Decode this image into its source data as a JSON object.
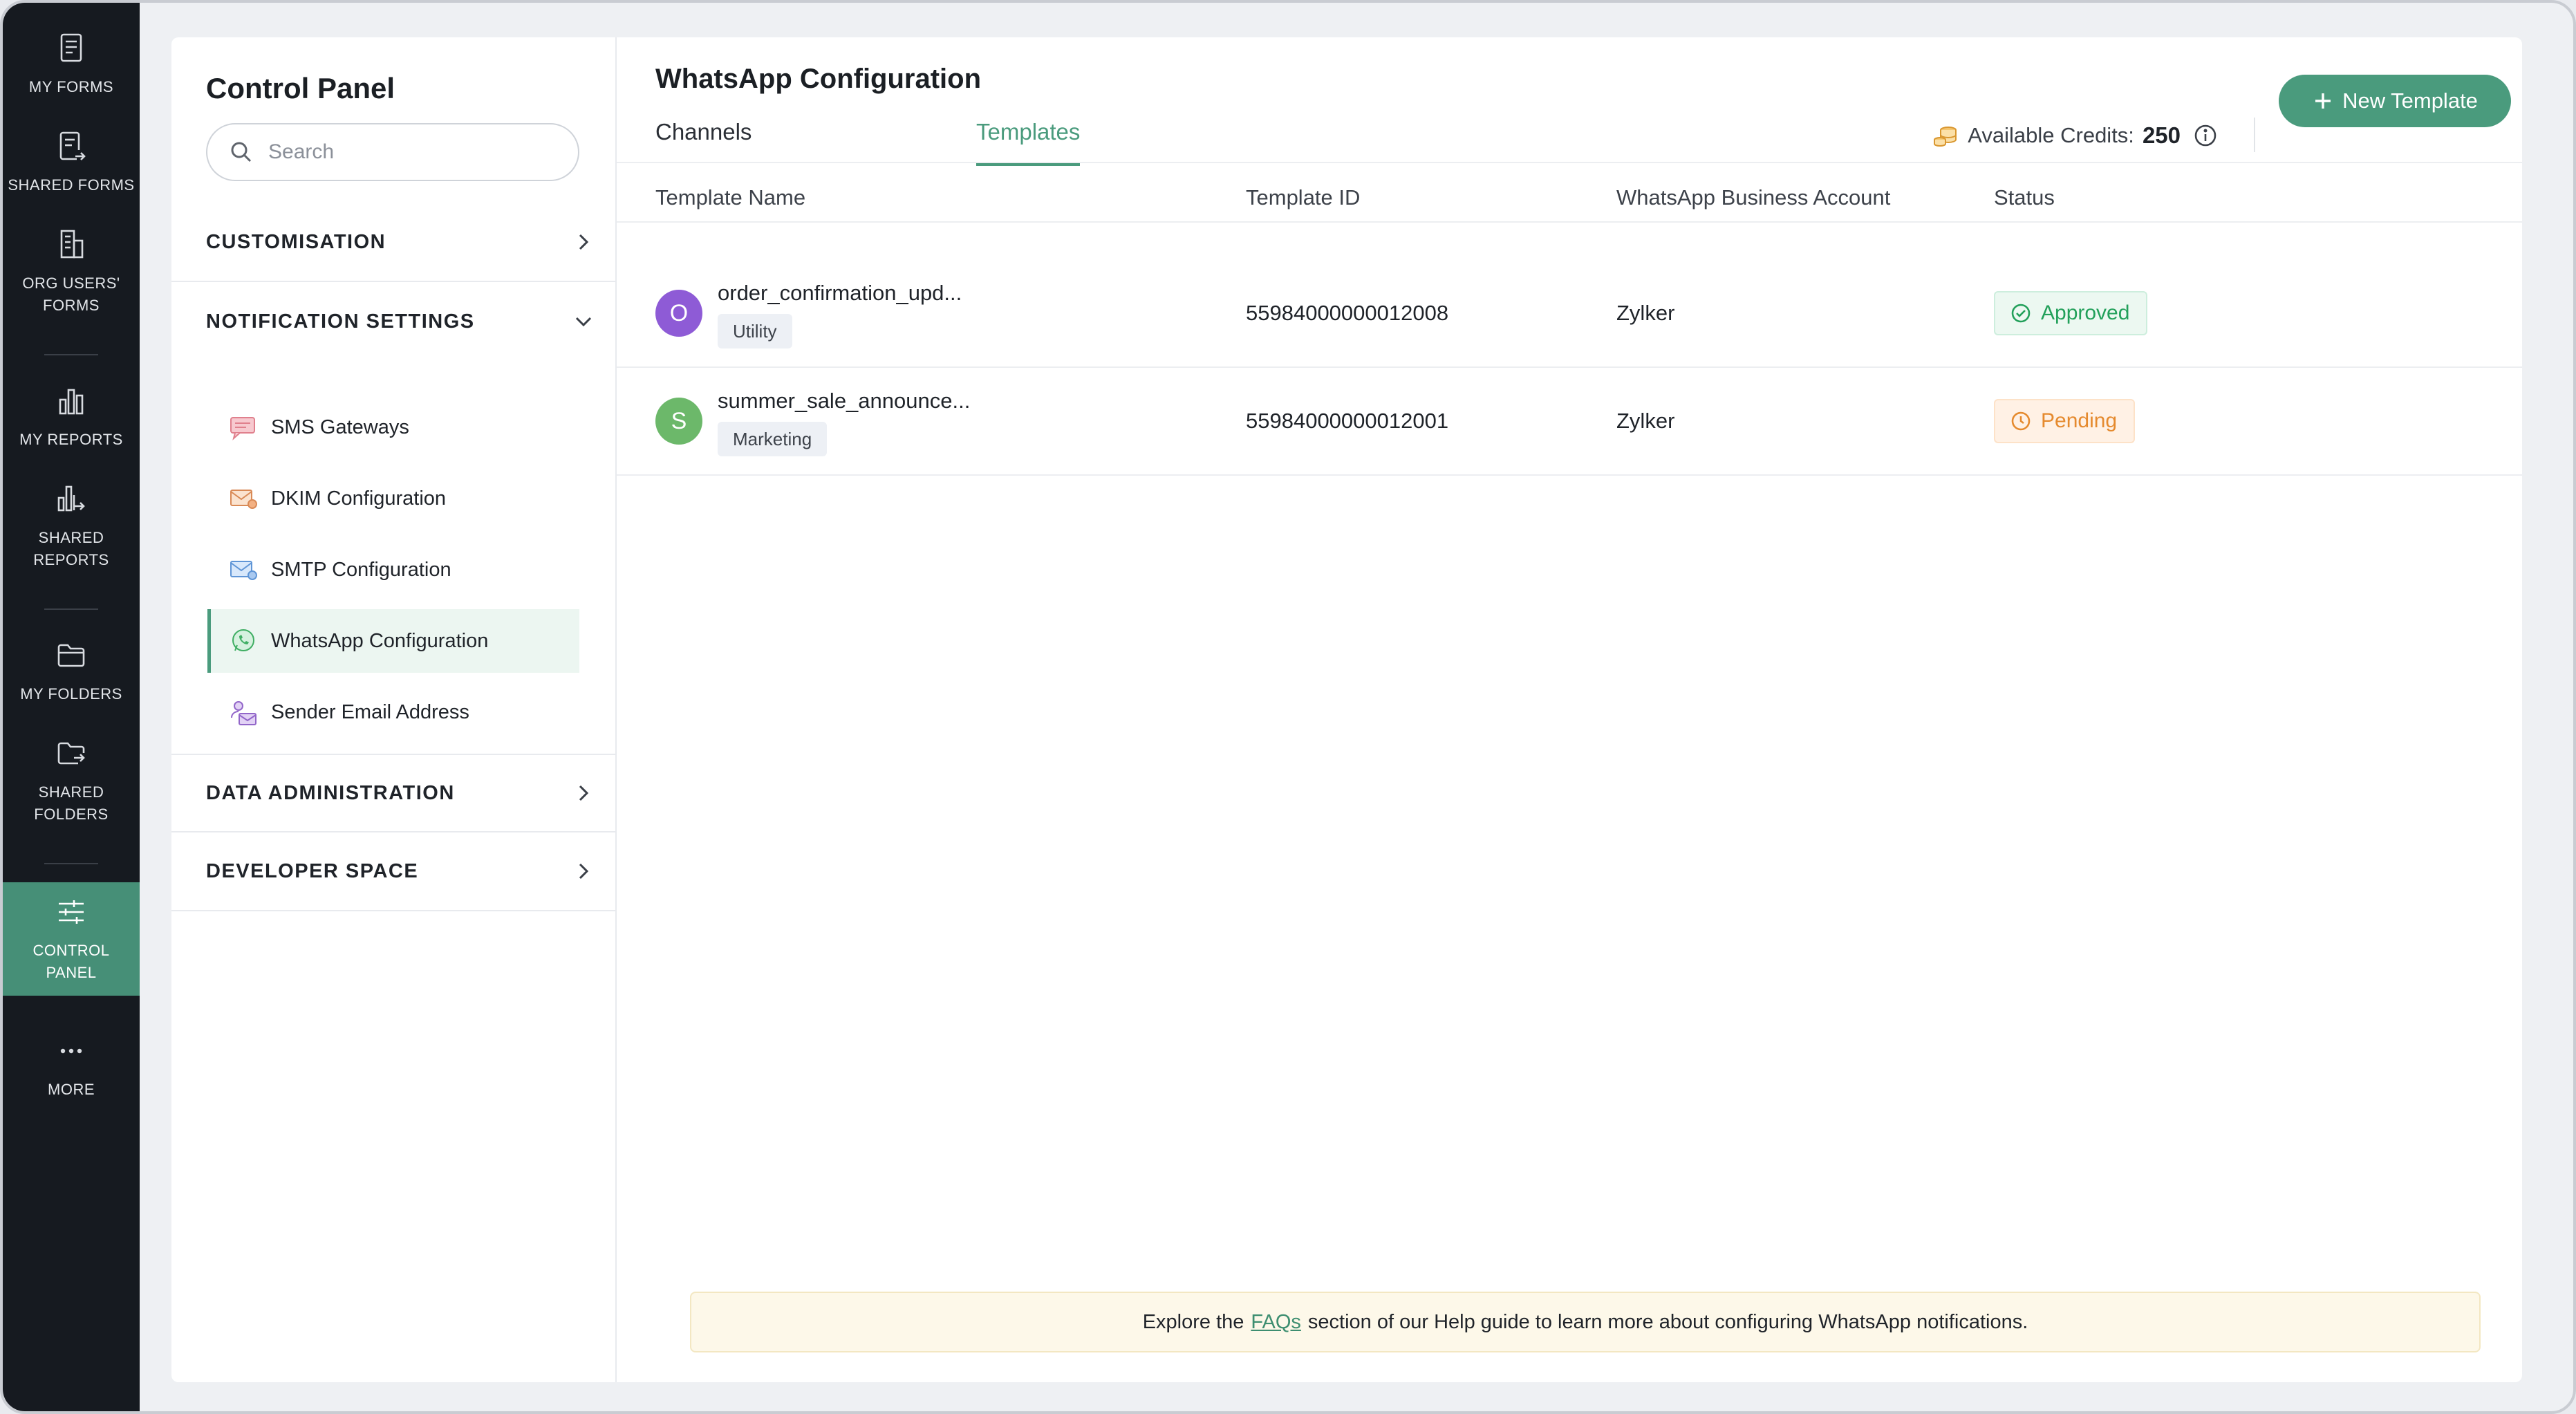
{
  "nav": {
    "my_forms": "MY FORMS",
    "shared_forms": "SHARED FORMS",
    "org_users_forms_1": "ORG USERS'",
    "org_users_forms_2": "FORMS",
    "my_reports": "MY REPORTS",
    "shared_reports_1": "SHARED",
    "shared_reports_2": "REPORTS",
    "my_folders": "MY FOLDERS",
    "shared_folders_1": "SHARED",
    "shared_folders_2": "FOLDERS",
    "control_panel_1": "CONTROL",
    "control_panel_2": "PANEL",
    "more": "MORE"
  },
  "sidebar": {
    "title": "Control Panel",
    "search_placeholder": "Search",
    "sections": {
      "customisation": "CUSTOMISATION",
      "notification_settings": "NOTIFICATION SETTINGS",
      "data_administration": "DATA ADMINISTRATION",
      "developer_space": "DEVELOPER SPACE"
    },
    "items": {
      "sms": "SMS Gateways",
      "dkim": "DKIM Configuration",
      "smtp": "SMTP Configuration",
      "whatsapp": "WhatsApp Configuration",
      "sender": "Sender Email Address"
    }
  },
  "main": {
    "title": "WhatsApp Configuration",
    "tabs": {
      "channels": "Channels",
      "templates": "Templates"
    },
    "credits_label": "Available Credits:",
    "credits_value": "250",
    "new_template": "New Template",
    "columns": {
      "name": "Template Name",
      "id": "Template ID",
      "account": "WhatsApp Business Account",
      "status": "Status"
    },
    "rows": [
      {
        "initial": "O",
        "name": "order_confirmation_upd...",
        "tag": "Utility",
        "id": "55984000000012008",
        "account": "Zylker",
        "status": "Approved"
      },
      {
        "initial": "S",
        "name": "summer_sale_announce...",
        "tag": "Marketing",
        "id": "55984000000012001",
        "account": "Zylker",
        "status": "Pending"
      }
    ],
    "info_before": "Explore the",
    "info_link": "FAQs",
    "info_after": "section of our Help guide to learn more about configuring WhatsApp notifications."
  },
  "colors": {
    "accent": "#4a9b7d",
    "nav_bg": "#161a20",
    "approved": "#22a05a",
    "pending": "#e58a2e",
    "avatar_o": "#8e5bd6",
    "avatar_s": "#6cb86a"
  }
}
